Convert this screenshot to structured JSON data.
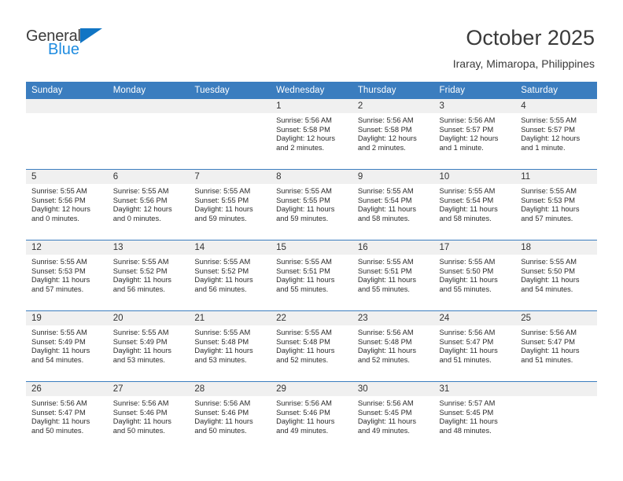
{
  "logo": {
    "word1": "General",
    "word2": "Blue",
    "triangle_color": "#1175c4",
    "blue_color": "#1f8ce0"
  },
  "header": {
    "title": "October 2025",
    "subtitle": "Iraray, Mimaropa, Philippines",
    "header_bg": "#3b7dbf",
    "daynum_bg": "#f0f0f0"
  },
  "weekdays": [
    "Sunday",
    "Monday",
    "Tuesday",
    "Wednesday",
    "Thursday",
    "Friday",
    "Saturday"
  ],
  "labels": {
    "sunrise_prefix": "Sunrise: ",
    "sunset_prefix": "Sunset: ",
    "daylight_prefix": "Daylight: "
  },
  "weeks": [
    [
      {
        "day": "",
        "empty": true
      },
      {
        "day": "",
        "empty": true
      },
      {
        "day": "",
        "empty": true
      },
      {
        "day": "1",
        "sunrise": "Sunrise: 5:56 AM",
        "sunset": "Sunset: 5:58 PM",
        "daylight": "Daylight: 12 hours and 2 minutes."
      },
      {
        "day": "2",
        "sunrise": "Sunrise: 5:56 AM",
        "sunset": "Sunset: 5:58 PM",
        "daylight": "Daylight: 12 hours and 2 minutes."
      },
      {
        "day": "3",
        "sunrise": "Sunrise: 5:56 AM",
        "sunset": "Sunset: 5:57 PM",
        "daylight": "Daylight: 12 hours and 1 minute."
      },
      {
        "day": "4",
        "sunrise": "Sunrise: 5:55 AM",
        "sunset": "Sunset: 5:57 PM",
        "daylight": "Daylight: 12 hours and 1 minute."
      }
    ],
    [
      {
        "day": "5",
        "sunrise": "Sunrise: 5:55 AM",
        "sunset": "Sunset: 5:56 PM",
        "daylight": "Daylight: 12 hours and 0 minutes."
      },
      {
        "day": "6",
        "sunrise": "Sunrise: 5:55 AM",
        "sunset": "Sunset: 5:56 PM",
        "daylight": "Daylight: 12 hours and 0 minutes."
      },
      {
        "day": "7",
        "sunrise": "Sunrise: 5:55 AM",
        "sunset": "Sunset: 5:55 PM",
        "daylight": "Daylight: 11 hours and 59 minutes."
      },
      {
        "day": "8",
        "sunrise": "Sunrise: 5:55 AM",
        "sunset": "Sunset: 5:55 PM",
        "daylight": "Daylight: 11 hours and 59 minutes."
      },
      {
        "day": "9",
        "sunrise": "Sunrise: 5:55 AM",
        "sunset": "Sunset: 5:54 PM",
        "daylight": "Daylight: 11 hours and 58 minutes."
      },
      {
        "day": "10",
        "sunrise": "Sunrise: 5:55 AM",
        "sunset": "Sunset: 5:54 PM",
        "daylight": "Daylight: 11 hours and 58 minutes."
      },
      {
        "day": "11",
        "sunrise": "Sunrise: 5:55 AM",
        "sunset": "Sunset: 5:53 PM",
        "daylight": "Daylight: 11 hours and 57 minutes."
      }
    ],
    [
      {
        "day": "12",
        "sunrise": "Sunrise: 5:55 AM",
        "sunset": "Sunset: 5:53 PM",
        "daylight": "Daylight: 11 hours and 57 minutes."
      },
      {
        "day": "13",
        "sunrise": "Sunrise: 5:55 AM",
        "sunset": "Sunset: 5:52 PM",
        "daylight": "Daylight: 11 hours and 56 minutes."
      },
      {
        "day": "14",
        "sunrise": "Sunrise: 5:55 AM",
        "sunset": "Sunset: 5:52 PM",
        "daylight": "Daylight: 11 hours and 56 minutes."
      },
      {
        "day": "15",
        "sunrise": "Sunrise: 5:55 AM",
        "sunset": "Sunset: 5:51 PM",
        "daylight": "Daylight: 11 hours and 55 minutes."
      },
      {
        "day": "16",
        "sunrise": "Sunrise: 5:55 AM",
        "sunset": "Sunset: 5:51 PM",
        "daylight": "Daylight: 11 hours and 55 minutes."
      },
      {
        "day": "17",
        "sunrise": "Sunrise: 5:55 AM",
        "sunset": "Sunset: 5:50 PM",
        "daylight": "Daylight: 11 hours and 55 minutes."
      },
      {
        "day": "18",
        "sunrise": "Sunrise: 5:55 AM",
        "sunset": "Sunset: 5:50 PM",
        "daylight": "Daylight: 11 hours and 54 minutes."
      }
    ],
    [
      {
        "day": "19",
        "sunrise": "Sunrise: 5:55 AM",
        "sunset": "Sunset: 5:49 PM",
        "daylight": "Daylight: 11 hours and 54 minutes."
      },
      {
        "day": "20",
        "sunrise": "Sunrise: 5:55 AM",
        "sunset": "Sunset: 5:49 PM",
        "daylight": "Daylight: 11 hours and 53 minutes."
      },
      {
        "day": "21",
        "sunrise": "Sunrise: 5:55 AM",
        "sunset": "Sunset: 5:48 PM",
        "daylight": "Daylight: 11 hours and 53 minutes."
      },
      {
        "day": "22",
        "sunrise": "Sunrise: 5:55 AM",
        "sunset": "Sunset: 5:48 PM",
        "daylight": "Daylight: 11 hours and 52 minutes."
      },
      {
        "day": "23",
        "sunrise": "Sunrise: 5:56 AM",
        "sunset": "Sunset: 5:48 PM",
        "daylight": "Daylight: 11 hours and 52 minutes."
      },
      {
        "day": "24",
        "sunrise": "Sunrise: 5:56 AM",
        "sunset": "Sunset: 5:47 PM",
        "daylight": "Daylight: 11 hours and 51 minutes."
      },
      {
        "day": "25",
        "sunrise": "Sunrise: 5:56 AM",
        "sunset": "Sunset: 5:47 PM",
        "daylight": "Daylight: 11 hours and 51 minutes."
      }
    ],
    [
      {
        "day": "26",
        "sunrise": "Sunrise: 5:56 AM",
        "sunset": "Sunset: 5:47 PM",
        "daylight": "Daylight: 11 hours and 50 minutes."
      },
      {
        "day": "27",
        "sunrise": "Sunrise: 5:56 AM",
        "sunset": "Sunset: 5:46 PM",
        "daylight": "Daylight: 11 hours and 50 minutes."
      },
      {
        "day": "28",
        "sunrise": "Sunrise: 5:56 AM",
        "sunset": "Sunset: 5:46 PM",
        "daylight": "Daylight: 11 hours and 50 minutes."
      },
      {
        "day": "29",
        "sunrise": "Sunrise: 5:56 AM",
        "sunset": "Sunset: 5:46 PM",
        "daylight": "Daylight: 11 hours and 49 minutes."
      },
      {
        "day": "30",
        "sunrise": "Sunrise: 5:56 AM",
        "sunset": "Sunset: 5:45 PM",
        "daylight": "Daylight: 11 hours and 49 minutes."
      },
      {
        "day": "31",
        "sunrise": "Sunrise: 5:57 AM",
        "sunset": "Sunset: 5:45 PM",
        "daylight": "Daylight: 11 hours and 48 minutes."
      },
      {
        "day": "",
        "empty": true
      }
    ]
  ]
}
